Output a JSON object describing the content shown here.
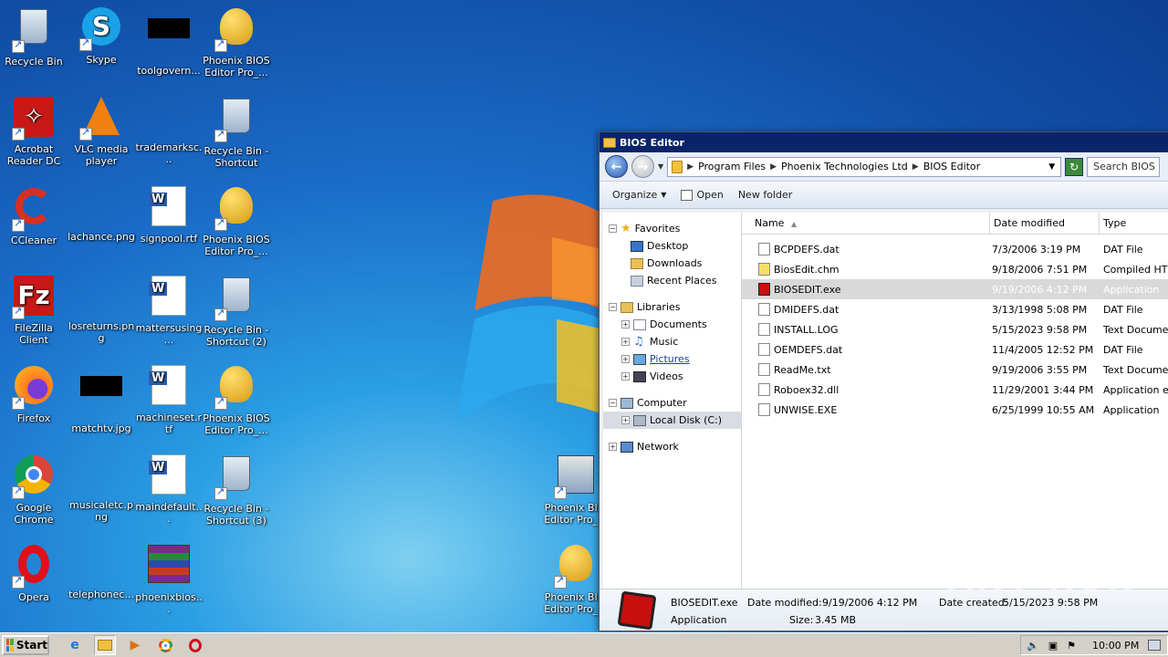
{
  "desktop": {
    "icons": [
      {
        "label": "Recycle Bin",
        "icon": "recycle-bin-icon"
      },
      {
        "label": "Skype",
        "icon": "skype-icon"
      },
      {
        "label": "toolgovern...",
        "icon": "black-image-icon"
      },
      {
        "label": "Phoenix BIOS Editor Pro_...",
        "icon": "keys-icon"
      },
      {
        "label": "Acrobat Reader DC",
        "icon": "acrobat-icon"
      },
      {
        "label": "VLC media player",
        "icon": "vlc-icon"
      },
      {
        "label": "trademarksc...",
        "icon": "blank-file-icon"
      },
      {
        "label": "Recycle Bin - Shortcut",
        "icon": "recycle-bin-icon"
      },
      {
        "label": "CCleaner",
        "icon": "ccleaner-icon"
      },
      {
        "label": "lachance.png",
        "icon": "blank-file-icon"
      },
      {
        "label": "signpool.rtf",
        "icon": "word-doc-icon"
      },
      {
        "label": "Phoenix BIOS Editor Pro_...",
        "icon": "keys-icon"
      },
      {
        "label": "FileZilla Client",
        "icon": "filezilla-icon"
      },
      {
        "label": "losreturns.png",
        "icon": "blank-file-icon"
      },
      {
        "label": "mattersusing...",
        "icon": "word-doc-icon"
      },
      {
        "label": "Recycle Bin - Shortcut (2)",
        "icon": "recycle-bin-icon"
      },
      {
        "label": "Firefox",
        "icon": "firefox-icon"
      },
      {
        "label": "matchtv.jpg",
        "icon": "black-image-icon"
      },
      {
        "label": "machineset.rtf",
        "icon": "word-doc-icon"
      },
      {
        "label": "Phoenix BIOS Editor Pro_...",
        "icon": "keys-icon"
      },
      {
        "label": "Google Chrome",
        "icon": "chrome-icon"
      },
      {
        "label": "musicaletc.png",
        "icon": "blank-file-icon"
      },
      {
        "label": "maindefault...",
        "icon": "word-doc-icon"
      },
      {
        "label": "Recycle Bin - Shortcut (3)",
        "icon": "recycle-bin-icon"
      },
      {
        "label": "Opera",
        "icon": "opera-icon"
      },
      {
        "label": "telephonec...",
        "icon": "blank-file-icon"
      },
      {
        "label": "phoenixbios...",
        "icon": "winrar-icon"
      },
      {
        "label": "Phoenix BI... Editor Pro_...",
        "icon": "installer-icon"
      },
      {
        "label": "Phoenix BI... Editor Pro_...",
        "icon": "keys-icon"
      }
    ]
  },
  "window": {
    "title": "BIOS Editor",
    "address": [
      "Program Files",
      "Phoenix Technologies Ltd",
      "BIOS Editor"
    ],
    "search_placeholder": "Search BIOS E",
    "toolbar": {
      "organize": "Organize",
      "open": "Open",
      "new_folder": "New folder"
    },
    "nav": {
      "favorites": "Favorites",
      "desktop": "Desktop",
      "downloads": "Downloads",
      "recent": "Recent Places",
      "libraries": "Libraries",
      "documents": "Documents",
      "music": "Music",
      "pictures": "Pictures",
      "videos": "Videos",
      "computer": "Computer",
      "local_disk": "Local Disk (C:)",
      "network": "Network"
    },
    "columns": {
      "name": "Name",
      "date": "Date modified",
      "type": "Type"
    },
    "files": [
      {
        "name": "BCPDEFS.dat",
        "date": "7/3/2006 3:19 PM",
        "type": "DAT File"
      },
      {
        "name": "BiosEdit.chm",
        "date": "9/18/2006 7:51 PM",
        "type": "Compiled HTM"
      },
      {
        "name": "BIOSEDIT.exe",
        "date": "9/19/2006 4:12 PM",
        "type": "Application"
      },
      {
        "name": "DMIDEFS.dat",
        "date": "3/13/1998 5:08 PM",
        "type": "DAT File"
      },
      {
        "name": "INSTALL.LOG",
        "date": "5/15/2023 9:58 PM",
        "type": "Text Documer"
      },
      {
        "name": "OEMDEFS.dat",
        "date": "11/4/2005 12:52 PM",
        "type": "DAT File"
      },
      {
        "name": "ReadMe.txt",
        "date": "9/19/2006 3:55 PM",
        "type": "Text Documer"
      },
      {
        "name": "Roboex32.dll",
        "date": "11/29/2001 3:44 PM",
        "type": "Application ex"
      },
      {
        "name": "UNWISE.EXE",
        "date": "6/25/1999 10:55 AM",
        "type": "Application"
      }
    ],
    "details": {
      "filename": "BIOSEDIT.exe",
      "type": "Application",
      "modified_label": "Date modified:",
      "modified": "9/19/2006 4:12 PM",
      "created_label": "Date created:",
      "created": "5/15/2023 9:58 PM",
      "size_label": "Size:",
      "size": "3.45 MB"
    }
  },
  "taskbar": {
    "start": "Start",
    "clock": "10:00 PM"
  },
  "watermark": "ANY RUN"
}
